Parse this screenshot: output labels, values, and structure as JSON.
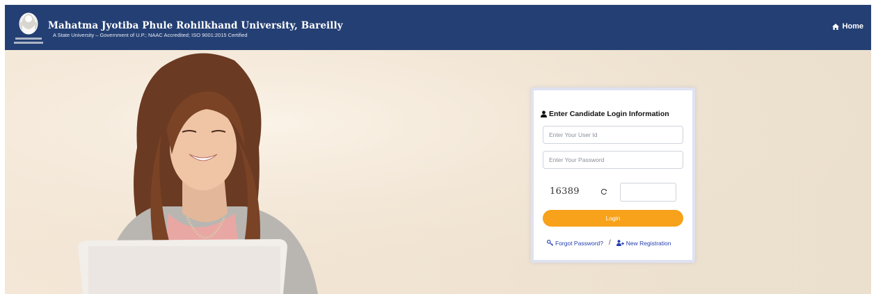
{
  "header": {
    "title": "Mahatma Jyotiba Phule Rohilkhand University, Bareilly",
    "subtitle": "A State University – Government of U.P.; NAAC Accredited; ISO 9001:2015 Certified",
    "home_label": "Home",
    "logo_icon": "university-crest-icon",
    "home_icon": "home-icon",
    "bg_color": "#243f73"
  },
  "login": {
    "heading": "Enter Candidate Login Information",
    "heading_icon": "user-icon",
    "userid_placeholder": "Enter Your User Id",
    "password_placeholder": "Enter Your Password",
    "captcha": "16389",
    "refresh_icon": "refresh-icon",
    "login_label": "Login",
    "forgot_label": "Forgot Password?",
    "separator": "/",
    "register_label": "New Registration",
    "accent_color": "#f8a11a",
    "link_color": "#2540b0"
  }
}
